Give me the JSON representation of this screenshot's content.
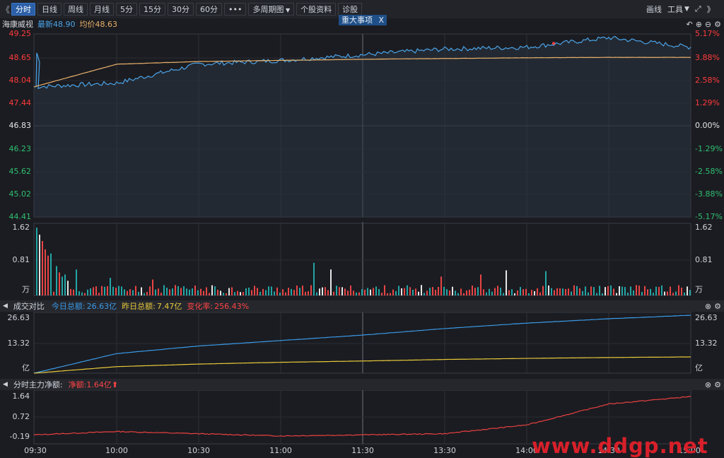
{
  "toolbar": {
    "nav_left": "《",
    "buttons": [
      "分时",
      "日线",
      "周线",
      "月线",
      "5分",
      "15分",
      "30分",
      "60分",
      "•••",
      "多周期图",
      "个股资料",
      "诊股"
    ],
    "active_index": 0,
    "draw_label": "画线",
    "tools_label": "工具",
    "expand_icon": "⤢",
    "nav_right": "》"
  },
  "info": {
    "stock_name": "海康威视",
    "latest_label": "最新",
    "latest_value": "48.90",
    "avg_label": "均价",
    "avg_value": "48.63",
    "event_tag": "重大事项",
    "event_close": "X"
  },
  "price_axis": {
    "left": [
      "49.25",
      "48.65",
      "48.04",
      "47.44",
      "46.83",
      "46.23",
      "45.62",
      "45.02",
      "44.41"
    ],
    "right": [
      "5.17%",
      "3.88%",
      "2.58%",
      "1.29%",
      "0.00%",
      "-1.29%",
      "-2.58%",
      "-3.88%",
      "-5.17%"
    ]
  },
  "volume_axis": {
    "top": "1.62",
    "mid": "0.81",
    "unit": "万"
  },
  "turnover": {
    "title": "成交对比",
    "today_label": "今日总额:",
    "today_value": "26.63亿",
    "yesterday_label": "昨日总额:",
    "yesterday_value": "7.47亿",
    "change_label": "变化率:",
    "change_value": "256.43%",
    "axis_top": "26.63",
    "axis_mid": "13.32",
    "unit": "亿"
  },
  "capital": {
    "title": "分时主力净额:",
    "net_label": "净额:",
    "net_value": "1.64亿",
    "arrow": "⬆",
    "axis": [
      "1.64",
      "0.72",
      "-0.19"
    ]
  },
  "time_axis": [
    "09:30",
    "10:00",
    "10:30",
    "11:00",
    "11:30",
    "13:30",
    "14:00",
    "14:30",
    "15:00"
  ],
  "watermark": "www.ddgp.net",
  "colors": {
    "up": "#ff3b3b",
    "down": "#2fbf71",
    "price_line": "#4aa3e8",
    "avg_line": "#e8b06a",
    "today_line": "#3a9ae8",
    "yesterday_line": "#e8c93a",
    "capital_line": "#e84040",
    "vol_red": "#e84545",
    "vol_teal": "#22a6a6",
    "vol_white": "#e6e6e6"
  },
  "chart_data": [
    {
      "type": "line",
      "ylim": [
        44.41,
        49.25
      ],
      "x": [
        "09:30",
        "10:00",
        "10:30",
        "11:00",
        "11:30",
        "13:30",
        "14:00",
        "14:30",
        "15:00"
      ],
      "series": [
        {
          "values": [
            47.85,
            47.95,
            48.45,
            48.55,
            48.7,
            48.85,
            48.9,
            49.15,
            48.9
          ]
        },
        {
          "values": [
            47.85,
            48.45,
            48.52,
            48.55,
            48.58,
            48.6,
            48.62,
            48.63,
            48.63
          ]
        }
      ]
    },
    {
      "type": "bar",
      "ylim": [
        0,
        1.62
      ],
      "categories": [
        "09:30",
        "10:00",
        "10:30",
        "11:00",
        "11:30",
        "13:30",
        "14:00",
        "14:30",
        "15:00"
      ],
      "values": [
        1.62,
        0.3,
        0.2,
        0.15,
        0.2,
        0.3,
        0.45,
        0.25,
        0.15
      ]
    },
    {
      "type": "line",
      "ylim": [
        0,
        26.63
      ],
      "x": [
        "09:30",
        "10:00",
        "10:30",
        "11:00",
        "11:30",
        "13:30",
        "14:00",
        "14:30",
        "15:00"
      ],
      "series": [
        {
          "values": [
            0,
            9,
            12.5,
            15,
            17.5,
            20.5,
            23,
            25,
            26.63
          ]
        },
        {
          "values": [
            0,
            3,
            4.2,
            5,
            5.6,
            6.3,
            6.8,
            7.2,
            7.47
          ]
        }
      ]
    },
    {
      "type": "line",
      "ylim": [
        -0.19,
        1.64
      ],
      "x": [
        "09:30",
        "10:00",
        "10:30",
        "11:00",
        "11:30",
        "13:30",
        "14:00",
        "14:30",
        "15:00"
      ],
      "series": [
        {
          "values": [
            -0.1,
            0.05,
            -0.05,
            -0.15,
            -0.1,
            -0.05,
            0.35,
            1.3,
            1.64
          ]
        }
      ]
    }
  ]
}
